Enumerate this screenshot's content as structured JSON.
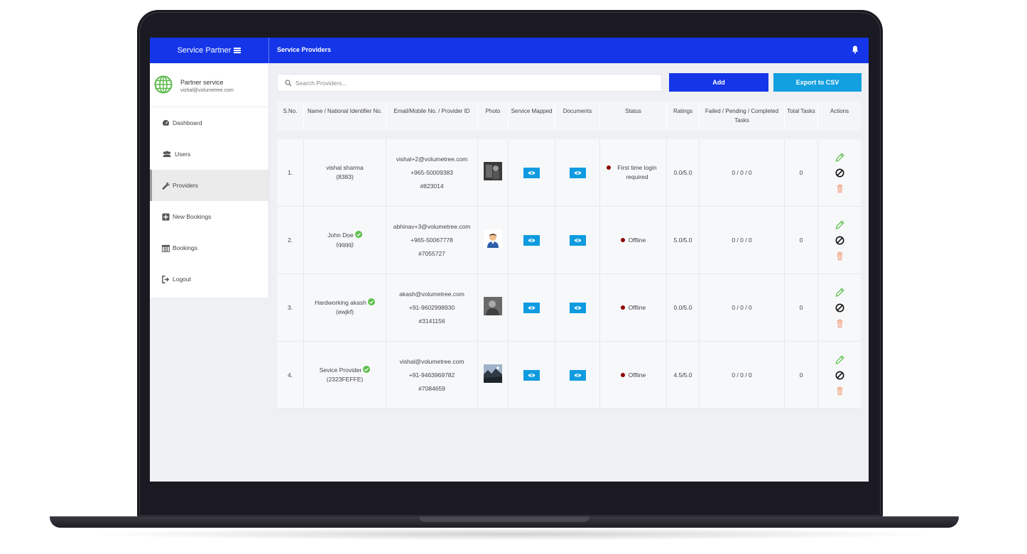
{
  "app": {
    "brand": "Service Partner",
    "page_title": "Service Providers"
  },
  "sidebar": {
    "profile_name": "Partner service",
    "profile_email": "vishal@volumetree.com",
    "items": [
      {
        "label": "Dashboard",
        "icon": "dashboard-icon"
      },
      {
        "label": "Users",
        "icon": "users-icon"
      },
      {
        "label": "Providers",
        "icon": "wrench-icon",
        "active": true
      },
      {
        "label": "New Bookings",
        "icon": "plus-square-icon"
      },
      {
        "label": "Bookings",
        "icon": "calendar-icon"
      },
      {
        "label": "Logout",
        "icon": "logout-icon"
      }
    ]
  },
  "toolbar": {
    "search_placeholder": "Search Providers...",
    "add_label": "Add",
    "export_label": "Export to CSV"
  },
  "table": {
    "headers": [
      "S.No.",
      "Name / National Identifier No.",
      "Email/Mobile No. / Provider ID",
      "Photo",
      "Service Mapped",
      "Documents",
      "Status",
      "Ratings",
      "Failed / Pending / Completed Tasks",
      "Total Tasks",
      "Actions"
    ],
    "rows": [
      {
        "sno": "1.",
        "name": "vishal sharma",
        "nid": "(8383)",
        "verified": false,
        "email": "vishal+2@volumetree.com",
        "mobile": "+965-50009383",
        "pid": "#823014",
        "photo": "dark-photo",
        "status": "First time login required",
        "rating": "0.0/5.0",
        "tasks": "0 / 0 / 0",
        "total": "0"
      },
      {
        "sno": "2.",
        "name": "John Doe",
        "nid": "(qqqq)",
        "verified": true,
        "email": "abhinav+3@volumetree.com",
        "mobile": "+965-50067778",
        "pid": "#7055727",
        "photo": "avatar-photo",
        "status": "Offline",
        "rating": "5.0/5.0",
        "tasks": "0 / 0 / 0",
        "total": "0"
      },
      {
        "sno": "3.",
        "name": "Hardworking akash",
        "nid": "(ewjkf)",
        "verified": true,
        "email": "akash@volumetree.com",
        "mobile": "+91-9602998930",
        "pid": "#3141156",
        "photo": "gray-photo",
        "status": "Offline",
        "rating": "0.0/5.0",
        "tasks": "0 / 0 / 0",
        "total": "0"
      },
      {
        "sno": "4.",
        "name": "Sevice Provider",
        "nid": "(2323FEFFE)",
        "verified": true,
        "email": "vishal@volumetree.com",
        "mobile": "+91-9463969782",
        "pid": "#7084659",
        "photo": "landscape-photo",
        "status": "Offline",
        "rating": "4.5/5.0",
        "tasks": "0 / 0 / 0",
        "total": "0"
      }
    ]
  },
  "colors": {
    "primary": "#1436e8",
    "export": "#12a0e0",
    "status_dot": "#8b0000",
    "edit": "#5cbf4a",
    "delete": "#f0a88a"
  }
}
